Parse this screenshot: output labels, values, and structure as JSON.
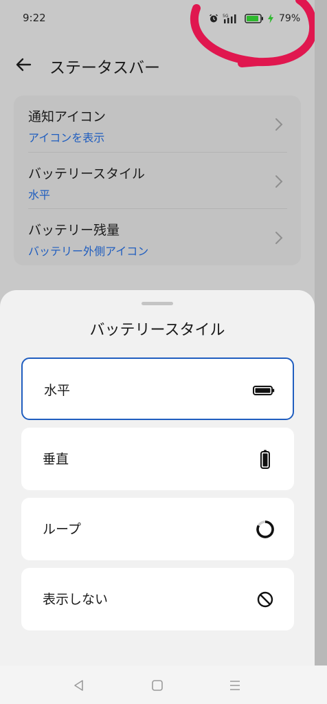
{
  "status_bar": {
    "time": "9:22",
    "network": "5G",
    "battery_percent": "79%",
    "icons": [
      "alarm-icon",
      "5g-icon",
      "signal-icon",
      "battery-icon",
      "charging-icon"
    ]
  },
  "header": {
    "title": "ステータスバー",
    "back_icon": "arrow-left-icon"
  },
  "settings": {
    "items": [
      {
        "title": "通知アイコン",
        "value": "アイコンを表示"
      },
      {
        "title": "バッテリースタイル",
        "value": "水平"
      },
      {
        "title": "バッテリー残量",
        "value": "バッテリー外側アイコン"
      }
    ]
  },
  "sheet": {
    "title": "バッテリースタイル",
    "options": [
      {
        "label": "水平",
        "icon": "battery-horizontal-icon",
        "selected": true
      },
      {
        "label": "垂直",
        "icon": "battery-vertical-icon",
        "selected": false
      },
      {
        "label": "ループ",
        "icon": "battery-ring-icon",
        "selected": false
      },
      {
        "label": "表示しない",
        "icon": "hide-icon",
        "selected": false
      }
    ]
  },
  "nav": {
    "icons": [
      "back-icon",
      "home-icon",
      "recents-icon"
    ]
  },
  "colors": {
    "accent": "#1f5dbf",
    "annotation": "#e0174f",
    "battery_green": "#2eb82e"
  }
}
